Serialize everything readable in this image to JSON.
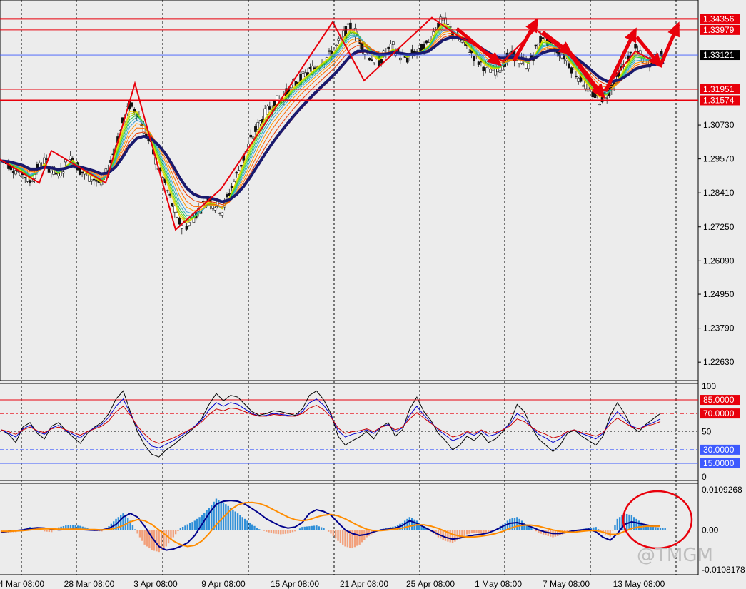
{
  "chart_data": {
    "type": "candlestick",
    "x_ticks": [
      "4 Mar 08:00",
      "28 Mar 08:00",
      "3 Apr 08:00",
      "9 Apr 08:00",
      "15 Apr 08:00",
      "21 Apr 08:00",
      "25 Apr 08:00",
      "1 May 08:00",
      "7 May 08:00",
      "13 May 08:00"
    ],
    "price_panel": {
      "ylim": [
        1.22,
        1.35
      ],
      "y_ticks": [
        "1.30730",
        "1.29570",
        "1.28410",
        "1.27250",
        "1.26090",
        "1.24950",
        "1.23790",
        "1.22630"
      ],
      "current_price": "1.33121",
      "level_labels": [
        "1.34356",
        "1.33979",
        "1.31951",
        "1.31574"
      ],
      "levels": [
        1.34356,
        1.33979,
        1.31951,
        1.31574
      ],
      "close_path": [
        1.295,
        1.294,
        1.292,
        1.291,
        1.288,
        1.292,
        1.295,
        1.292,
        1.29,
        1.294,
        1.296,
        1.292,
        1.29,
        1.289,
        1.287,
        1.292,
        1.3,
        1.308,
        1.314,
        1.312,
        1.306,
        1.3,
        1.293,
        1.287,
        1.28,
        1.274,
        1.273,
        1.276,
        1.279,
        1.282,
        1.28,
        1.278,
        1.284,
        1.29,
        1.296,
        1.302,
        1.307,
        1.311,
        1.314,
        1.316,
        1.318,
        1.321,
        1.323,
        1.325,
        1.327,
        1.329,
        1.331,
        1.334,
        1.338,
        1.341,
        1.338,
        1.333,
        1.33,
        1.329,
        1.332,
        1.334,
        1.331,
        1.33,
        1.332,
        1.333,
        1.335,
        1.341,
        1.343,
        1.34,
        1.337,
        1.335,
        1.332,
        1.329,
        1.327,
        1.326,
        1.327,
        1.33,
        1.331,
        1.329,
        1.328,
        1.333,
        1.338,
        1.335,
        1.333,
        1.331,
        1.327,
        1.324,
        1.321,
        1.318,
        1.316,
        1.318,
        1.322,
        1.326,
        1.33,
        1.333,
        1.33,
        1.329,
        1.33,
        1.331
      ]
    },
    "rsi_panel": {
      "ylim": [
        0,
        100
      ],
      "y_ticks": [
        "100",
        "50",
        "0"
      ],
      "level_labels": [
        "85.0000",
        "70.0000",
        "30.0000",
        "15.0000"
      ],
      "levels": [
        85,
        70,
        30,
        15
      ],
      "black_line": [
        52,
        47,
        38,
        55,
        60,
        48,
        42,
        56,
        60,
        51,
        44,
        37,
        48,
        55,
        60,
        70,
        86,
        95,
        72,
        50,
        35,
        25,
        22,
        30,
        35,
        42,
        48,
        55,
        65,
        80,
        92,
        84,
        90,
        88,
        80,
        72,
        68,
        70,
        73,
        72,
        70,
        68,
        75,
        90,
        95,
        85,
        70,
        45,
        35,
        40,
        44,
        50,
        42,
        55,
        60,
        45,
        52,
        75,
        88,
        72,
        62,
        48,
        40,
        30,
        35,
        45,
        40,
        48,
        38,
        42,
        50,
        60,
        80,
        72,
        55,
        42,
        35,
        28,
        35,
        48,
        52,
        45,
        40,
        35,
        45,
        68,
        82,
        70,
        55,
        50,
        58,
        64,
        70
      ],
      "blue_line": [
        52,
        48,
        44,
        53,
        57,
        50,
        47,
        54,
        57,
        51,
        47,
        43,
        50,
        54,
        58,
        66,
        78,
        86,
        70,
        54,
        42,
        34,
        32,
        36,
        40,
        45,
        50,
        56,
        63,
        74,
        82,
        78,
        82,
        80,
        75,
        70,
        67,
        68,
        70,
        69,
        68,
        67,
        72,
        82,
        86,
        79,
        68,
        51,
        44,
        47,
        49,
        52,
        48,
        55,
        58,
        50,
        54,
        68,
        78,
        68,
        60,
        52,
        46,
        40,
        43,
        49,
        46,
        51,
        45,
        47,
        52,
        58,
        70,
        65,
        55,
        47,
        43,
        38,
        42,
        50,
        52,
        48,
        45,
        42,
        48,
        62,
        72,
        64,
        56,
        53,
        57,
        60,
        64
      ],
      "red_line": [
        52,
        50,
        47,
        52,
        55,
        51,
        49,
        53,
        55,
        52,
        49,
        46,
        50,
        53,
        56,
        62,
        72,
        78,
        68,
        56,
        47,
        40,
        37,
        40,
        43,
        47,
        51,
        55,
        61,
        69,
        75,
        73,
        76,
        75,
        72,
        69,
        67,
        67,
        69,
        68,
        67,
        67,
        70,
        76,
        79,
        74,
        66,
        54,
        48,
        50,
        51,
        53,
        50,
        55,
        57,
        52,
        55,
        64,
        71,
        65,
        59,
        53,
        49,
        44,
        46,
        50,
        48,
        52,
        48,
        49,
        52,
        56,
        64,
        61,
        55,
        50,
        47,
        43,
        45,
        50,
        52,
        49,
        47,
        45,
        49,
        58,
        65,
        60,
        55,
        53,
        56,
        58,
        61
      ]
    },
    "macd_panel": {
      "ylim": [
        -0.0108178,
        0.0109268
      ],
      "y_ticks": [
        "0.0109268",
        "0.00",
        "-0.0108178"
      ],
      "histogram": [
        -0.0008,
        -0.0007,
        -0.0006,
        0.0001,
        0.0008,
        0.0004,
        -0.0004,
        -0.0006,
        0.0007,
        0.0012,
        0.0013,
        0.0011,
        0.0005,
        -0.0003,
        -0.0004,
        0.001,
        0.003,
        0.0045,
        0.0025,
        -0.001,
        -0.004,
        -0.0055,
        -0.006,
        -0.0045,
        -0.002,
        0.0005,
        0.0015,
        0.0025,
        0.004,
        0.006,
        0.0085,
        0.0075,
        0.006,
        0.0045,
        0.003,
        0.0015,
        0.0002,
        -0.0005,
        -0.001,
        -0.0012,
        -0.001,
        -0.0004,
        0.0008,
        0.001,
        0.0012,
        0.0005,
        -0.001,
        -0.003,
        -0.0045,
        -0.005,
        -0.004,
        -0.002,
        -0.0008,
        0.0002,
        0.0006,
        0.001,
        0.002,
        0.0035,
        0.0025,
        0.001,
        -0.0005,
        -0.002,
        -0.003,
        -0.0035,
        -0.0025,
        -0.0012,
        -0.0008,
        -0.001,
        -0.0006,
        0.0002,
        0.0015,
        0.003,
        0.0035,
        0.002,
        0.0005,
        -0.0008,
        -0.0015,
        -0.002,
        -0.0015,
        -0.0008,
        -0.0004,
        0.0002,
        0.0005,
        0.0008,
        -0.001,
        -0.0018,
        0.003,
        0.0045,
        0.004,
        0.0025,
        0.0012,
        0.0008,
        0.0006
      ],
      "macd_line": [
        -0.0006,
        -0.0004,
        -0.0002,
        0.0,
        0.0004,
        0.0006,
        0.0005,
        0.0002,
        0.0,
        0.0001,
        0.0002,
        0.0001,
        0.0,
        -0.0001,
        0.0,
        0.0004,
        0.0015,
        0.0035,
        0.0045,
        0.0035,
        0.001,
        -0.002,
        -0.0045,
        -0.0055,
        -0.0052,
        -0.0045,
        -0.0035,
        -0.0015,
        0.0015,
        0.0045,
        0.007,
        0.0078,
        0.008,
        0.0078,
        0.007,
        0.0058,
        0.0045,
        0.003,
        0.002,
        0.001,
        0.0005,
        0.0008,
        0.002,
        0.0045,
        0.0055,
        0.005,
        0.004,
        0.002,
        0.0,
        -0.001,
        -0.0015,
        -0.0012,
        -0.0005,
        0.0,
        0.0002,
        0.0005,
        0.0012,
        0.0025,
        0.0018,
        0.0008,
        -0.0002,
        -0.0012,
        -0.002,
        -0.0025,
        -0.0022,
        -0.0018,
        -0.0014,
        -0.0012,
        -0.0008,
        0.0,
        0.001,
        0.0018,
        0.002,
        0.0015,
        0.0008,
        0.0,
        -0.0006,
        -0.001,
        -0.001,
        -0.0006,
        -0.0002,
        0.0,
        0.0002,
        -0.0005,
        -0.002,
        -0.0028,
        -0.001,
        0.0015,
        0.0022,
        0.0018,
        0.0014,
        0.001,
        0.001
      ],
      "signal_line": [
        -0.0004,
        -0.0004,
        -0.0003,
        -0.0002,
        0.0,
        0.0002,
        0.0003,
        0.0003,
        0.0002,
        0.0002,
        0.0002,
        0.0002,
        0.0001,
        0.0001,
        0.0,
        0.0001,
        0.0005,
        0.0012,
        0.0022,
        0.0028,
        0.0025,
        0.0015,
        0.0,
        -0.0015,
        -0.003,
        -0.004,
        -0.0045,
        -0.0042,
        -0.003,
        -0.001,
        0.0015,
        0.0035,
        0.0055,
        0.0068,
        0.0074,
        0.0075,
        0.0072,
        0.0065,
        0.0055,
        0.0045,
        0.0035,
        0.0028,
        0.0025,
        0.0028,
        0.0035,
        0.004,
        0.0042,
        0.0038,
        0.003,
        0.002,
        0.001,
        0.0002,
        -0.0002,
        -0.0002,
        0.0,
        0.0002,
        0.0005,
        0.001,
        0.0014,
        0.0014,
        0.001,
        0.0004,
        -0.0004,
        -0.0012,
        -0.0017,
        -0.0019,
        -0.0019,
        -0.0017,
        -0.0014,
        -0.001,
        -0.0004,
        0.0004,
        0.001,
        0.0013,
        0.0013,
        0.001,
        0.0005,
        0.0,
        -0.0004,
        -0.0006,
        -0.0006,
        -0.0004,
        -0.0002,
        -0.0002,
        -0.0006,
        -0.0012,
        -0.0012,
        -0.0004,
        0.0004,
        0.0008,
        0.001,
        0.001,
        0.001
      ]
    }
  },
  "watermark": "@TMGM",
  "colors": {
    "background": "#ececec",
    "level_line": "#e8000b",
    "current_price_line": "#3d5afe",
    "candle_bull": "#00a000",
    "candle_bear": "#cc0000",
    "ma_slow": "#1a1a6e",
    "rsi_black": "#000000",
    "rsi_blue": "#0000cc",
    "rsi_red": "#cc0000",
    "macd_hist_pos": "#2f8fd8",
    "macd_hist_neg": "#f2a07b",
    "macd_line": "#00008b",
    "signal_line": "#ff8c00",
    "zigzag": "#e8000b"
  }
}
